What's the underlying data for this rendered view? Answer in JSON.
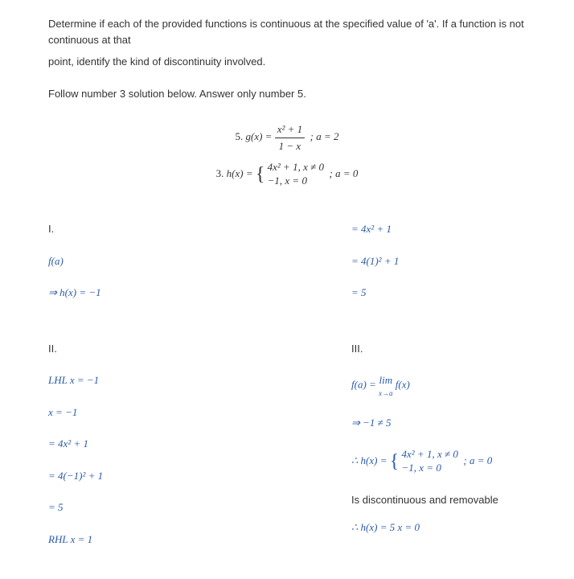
{
  "intro_line1": "Determine if each of the provided functions is continuous at the specified value of 'a'. If a function is not continuous at that",
  "intro_line2": "point, identify the kind of discontinuity involved.",
  "instruction": "Follow number 3 solution below. Answer only number 5.",
  "problem5": {
    "label": "5.",
    "func": "g(x) =",
    "num": "x² + 1",
    "den": "1 − x",
    "cond": ";   a = 2"
  },
  "problem3": {
    "label": "3.",
    "func": "h(x) =",
    "p1": "4x² + 1",
    "c1": ",   x ≠ 0",
    "p2": "−1",
    "c2": ",   x = 0",
    "cond": ";   a = 0"
  },
  "left": {
    "roman1": "I.",
    "fa": "f(a)",
    "step1": "⇒ h(x) = −1",
    "roman2": "II.",
    "lhl": "LHL    x = −1",
    "s1": "x = −1",
    "s2": "= 4x² + 1",
    "s3": "= 4(−1)² + 1",
    "s4": "= 5",
    "rhl": "RHL    x = 1"
  },
  "right": {
    "r1": "= 4x² + 1",
    "r2": "= 4(1)² + 1",
    "r3": "= 5",
    "roman3": "III.",
    "r4": "f(a) = ",
    "r4_lim": "lim",
    "r4_sub": "x→a",
    "r4_end": " f(x)",
    "r5": "⇒ −1 ≠ 5",
    "r6_pre": "∴ h(x) =",
    "r6_p1": "4x² + 1",
    "r6_c1": ",   x ≠ 0",
    "r6_p2": "−1",
    "r6_c2": ",   x = 0",
    "r6_cond": ";   a = 0",
    "conclusion": "Is discontinuous and removable",
    "r7": "∴ h(x) = 5    x = 0"
  }
}
